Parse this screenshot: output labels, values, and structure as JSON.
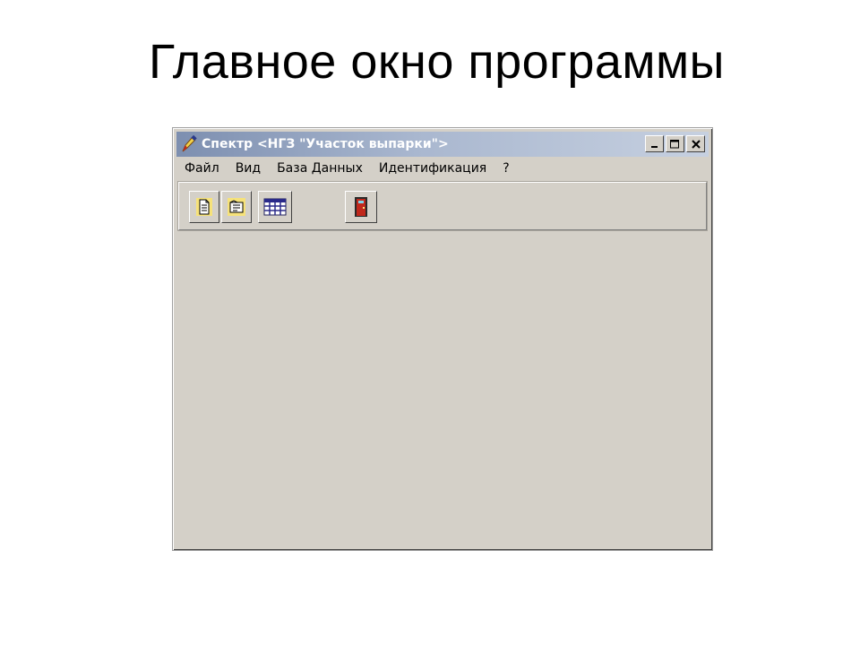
{
  "slide": {
    "title": "Главное окно программы"
  },
  "window": {
    "title": "Спектр <НГЗ \"Участок выпарки\">",
    "icon": "pencil-app-icon",
    "controls": {
      "minimize_icon": "minimize-icon",
      "maximize_icon": "maximize-icon",
      "close_icon": "close-icon"
    }
  },
  "menubar": {
    "items": [
      {
        "label": "Файл"
      },
      {
        "label": "Вид"
      },
      {
        "label": "База Данных"
      },
      {
        "label": "Идентификация"
      },
      {
        "label": "?"
      }
    ]
  },
  "toolbar": {
    "buttons": [
      {
        "icon": "new-document-icon"
      },
      {
        "icon": "open-document-icon"
      },
      {
        "icon": "table-grid-icon"
      },
      {
        "icon": "exit-door-icon"
      }
    ]
  },
  "colors": {
    "window_bg": "#d4d0c8",
    "titlebar_start": "#7d8fb0",
    "titlebar_end": "#c6d0e0",
    "door_red": "#c0281c"
  }
}
